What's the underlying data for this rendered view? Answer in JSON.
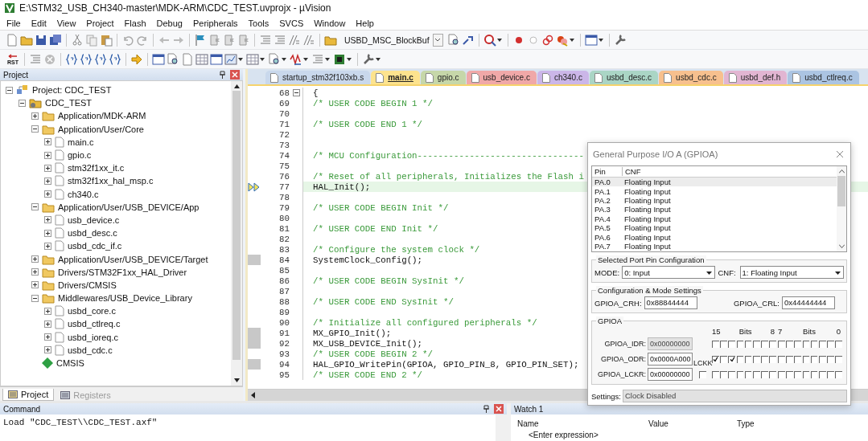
{
  "window": {
    "title": "E:\\STM32_USB_CH340-master\\MDK-ARM\\CDC_TEST.uvprojx - µVision"
  },
  "menu": [
    "File",
    "Edit",
    "View",
    "Project",
    "Flash",
    "Debug",
    "Peripherals",
    "Tools",
    "SVCS",
    "Window",
    "Help"
  ],
  "toolbar": {
    "find_field": {
      "value": "USBD_MSC_BlockBuf"
    },
    "reset_label": "RST"
  },
  "project": {
    "title": "Project",
    "tree": [
      {
        "label": "Project: CDC_TEST",
        "kind": "project",
        "expanded": true,
        "children": [
          {
            "label": "CDC_TEST",
            "kind": "target",
            "expanded": true,
            "children": [
              {
                "label": "Application/MDK-ARM",
                "kind": "group",
                "expanded": false
              },
              {
                "label": "Application/User/Core",
                "kind": "group",
                "expanded": true,
                "children": [
                  {
                    "label": "main.c",
                    "kind": "file",
                    "expanded": false
                  },
                  {
                    "label": "gpio.c",
                    "kind": "file",
                    "expanded": false
                  },
                  {
                    "label": "stm32f1xx_it.c",
                    "kind": "file",
                    "expanded": false
                  },
                  {
                    "label": "stm32f1xx_hal_msp.c",
                    "kind": "file",
                    "expanded": false
                  },
                  {
                    "label": "ch340.c",
                    "kind": "file",
                    "expanded": false
                  }
                ]
              },
              {
                "label": "Application/User/USB_DEVICE/App",
                "kind": "group",
                "expanded": true,
                "children": [
                  {
                    "label": "usb_device.c",
                    "kind": "file",
                    "expanded": false
                  },
                  {
                    "label": "usbd_desc.c",
                    "kind": "file",
                    "expanded": false
                  },
                  {
                    "label": "usbd_cdc_if.c",
                    "kind": "file",
                    "expanded": false
                  }
                ]
              },
              {
                "label": "Application/User/USB_DEVICE/Target",
                "kind": "group",
                "expanded": false
              },
              {
                "label": "Drivers/STM32F1xx_HAL_Driver",
                "kind": "group",
                "expanded": false
              },
              {
                "label": "Drivers/CMSIS",
                "kind": "group",
                "expanded": false
              },
              {
                "label": "Middlewares/USB_Device_Library",
                "kind": "group",
                "expanded": true,
                "children": [
                  {
                    "label": "usbd_core.c",
                    "kind": "file",
                    "expanded": false
                  },
                  {
                    "label": "usbd_ctlreq.c",
                    "kind": "file",
                    "expanded": false
                  },
                  {
                    "label": "usbd_ioreq.c",
                    "kind": "file",
                    "expanded": false
                  },
                  {
                    "label": "usbd_cdc.c",
                    "kind": "file",
                    "expanded": false
                  }
                ]
              },
              {
                "label": "CMSIS",
                "kind": "component"
              }
            ]
          }
        ]
      }
    ],
    "tabs": [
      {
        "label": "Project",
        "selected": true
      },
      {
        "label": "Registers",
        "selected": false
      }
    ]
  },
  "editor": {
    "tabs": [
      {
        "label": "startup_stm32f103xb.s",
        "selected": false,
        "color": "#c9d8ec"
      },
      {
        "label": "main.c",
        "selected": true,
        "color": "#fde38e"
      },
      {
        "label": "gpio.c",
        "selected": false,
        "color": "#c6d7a9"
      },
      {
        "label": "usb_device.c",
        "selected": false,
        "color": "#f0a8a8"
      },
      {
        "label": "ch340.c",
        "selected": false,
        "color": "#cbb6e8"
      },
      {
        "label": "usbd_desc.c",
        "selected": false,
        "color": "#aad5c5"
      },
      {
        "label": "usbd_cdc.c",
        "selected": false,
        "color": "#f7c08e"
      },
      {
        "label": "usbd_def.h",
        "selected": false,
        "color": "#e2b5d2"
      },
      {
        "label": "usbd_ctlreq.c",
        "selected": false,
        "color": "#abc4e2"
      }
    ],
    "lines": [
      {
        "number": "68",
        "text": "{",
        "kind": "code",
        "foldable": true,
        "executable": false,
        "current": false
      },
      {
        "number": "69",
        "text": "/* USER CODE BEGIN 1 */",
        "kind": "comment",
        "foldable": false,
        "executable": false,
        "current": false
      },
      {
        "number": "70",
        "foldable": false,
        "executable": false,
        "current": false
      },
      {
        "number": "71",
        "text": "/* USER CODE END 1 */",
        "kind": "comment",
        "foldable": false,
        "executable": false,
        "current": false
      },
      {
        "number": "72",
        "foldable": false,
        "executable": false,
        "current": false
      },
      {
        "number": "73",
        "foldable": false,
        "executable": false,
        "current": false
      },
      {
        "number": "74",
        "text": "/* MCU Configuration--------------------------------",
        "kind": "comment",
        "foldable": false,
        "executable": false,
        "current": false
      },
      {
        "number": "75",
        "foldable": false,
        "executable": false,
        "current": false
      },
      {
        "number": "76",
        "text": "/* Reset of all peripherals, Initializes the Flash i",
        "kind": "comment",
        "foldable": false,
        "executable": false,
        "current": false
      },
      {
        "number": "77",
        "text": "HAL_Init();",
        "kind": "code",
        "foldable": false,
        "executable": false,
        "current": true
      },
      {
        "number": "78",
        "foldable": false,
        "executable": false,
        "current": false
      },
      {
        "number": "79",
        "text": "/* USER CODE BEGIN Init */",
        "kind": "comment",
        "foldable": false,
        "executable": false,
        "current": false
      },
      {
        "number": "80",
        "foldable": false,
        "executable": false,
        "current": false
      },
      {
        "number": "81",
        "text": "/* USER CODE END Init */",
        "kind": "comment",
        "foldable": false,
        "executable": false,
        "current": false
      },
      {
        "number": "82",
        "foldable": false,
        "executable": false,
        "current": false
      },
      {
        "number": "83",
        "text": "/* Configure the system clock */",
        "kind": "comment",
        "foldable": false,
        "executable": false,
        "current": false
      },
      {
        "number": "84",
        "text": "SystemClock_Config();",
        "kind": "code",
        "foldable": false,
        "executable": true,
        "current": false
      },
      {
        "number": "85",
        "foldable": false,
        "executable": false,
        "current": false
      },
      {
        "number": "86",
        "text": "/* USER CODE BEGIN SysInit */",
        "kind": "comment",
        "foldable": false,
        "executable": false,
        "current": false
      },
      {
        "number": "87",
        "foldable": false,
        "executable": false,
        "current": false
      },
      {
        "number": "88",
        "text": "/* USER CODE END SysInit */",
        "kind": "comment",
        "foldable": false,
        "executable": false,
        "current": false
      },
      {
        "number": "89",
        "foldable": false,
        "executable": false,
        "current": false
      },
      {
        "number": "90",
        "text": "/* Initialize all configured peripherals */",
        "kind": "comment",
        "foldable": false,
        "executable": false,
        "current": false
      },
      {
        "number": "91",
        "text": "MX_GPIO_Init();",
        "kind": "code",
        "foldable": false,
        "executable": true,
        "current": false
      },
      {
        "number": "92",
        "text": "MX_USB_DEVICE_Init();",
        "kind": "code",
        "foldable": false,
        "executable": true,
        "current": false
      },
      {
        "number": "93",
        "text": "/* USER CODE BEGIN 2 */",
        "kind": "comment",
        "foldable": false,
        "executable": false,
        "current": false
      },
      {
        "number": "94",
        "text": "HAL_GPIO_WritePin(GPIOA, GPIO_PIN_8, GPIO_PIN_SET);",
        "kind": "code",
        "foldable": false,
        "executable": true,
        "current": false
      },
      {
        "number": "95",
        "text": "/* USER CODE END 2 */",
        "kind": "comment",
        "foldable": false,
        "executable": false,
        "current": false
      }
    ]
  },
  "command": {
    "title": "Command",
    "output": "Load \"CDC_TEST\\\\CDC_TEST.axf\""
  },
  "watch": {
    "title": "Watch 1",
    "columns": [
      "Name",
      "Value",
      "Type"
    ],
    "placeholder_row": "<Enter expression>"
  },
  "dialog": {
    "title": "General Purpose I/O A (GPIOA)",
    "columns": [
      "Pin",
      "CNF"
    ],
    "pins": [
      {
        "pin": "PA.0",
        "cnf": "Floating Input",
        "selected": true
      },
      {
        "pin": "PA.1",
        "cnf": "Floating Input",
        "selected": false
      },
      {
        "pin": "PA.2",
        "cnf": "Floating Input",
        "selected": false
      },
      {
        "pin": "PA.3",
        "cnf": "Floating Input",
        "selected": false
      },
      {
        "pin": "PA.4",
        "cnf": "Floating Input",
        "selected": false
      },
      {
        "pin": "PA.5",
        "cnf": "Floating Input",
        "selected": false
      },
      {
        "pin": "PA.6",
        "cnf": "Floating Input",
        "selected": false
      },
      {
        "pin": "PA.7",
        "cnf": "Floating Input",
        "selected": false
      }
    ],
    "pin_config": {
      "title": "Selected Port Pin Configuration",
      "mode_label": "MODE:",
      "mode_value": "0: Input",
      "cnf_label": "CNF:",
      "cnf_value": "1: Floating Input"
    },
    "mode_settings": {
      "title": "Configuration & Mode Settings",
      "crh_label": "GPIOA_CRH:",
      "crh_value": "0x88844444",
      "crl_label": "GPIOA_CRL:",
      "crl_value": "0x44444444"
    },
    "port": {
      "title": "GPIOA",
      "bit_header": [
        "15",
        "Bits",
        "8",
        "7",
        "Bits",
        "0"
      ],
      "lckk": {
        "label": "LCKK",
        "checked": false
      },
      "registers": [
        {
          "label": "GPIOA_IDR:",
          "value": "0x00000000",
          "readonly": true,
          "bits": [
            false,
            false,
            false,
            false,
            false,
            false,
            false,
            false,
            false,
            false,
            false,
            false,
            false,
            false,
            false,
            false
          ]
        },
        {
          "label": "GPIOA_ODR:",
          "value": "0x0000A000",
          "readonly": false,
          "bits": [
            true,
            false,
            true,
            false,
            false,
            false,
            false,
            false,
            false,
            false,
            false,
            false,
            false,
            false,
            false,
            false
          ]
        },
        {
          "label": "GPIOA_LCKR:",
          "value": "0x00000000",
          "readonly": false,
          "bits": [
            false,
            false,
            false,
            false,
            false,
            false,
            false,
            false,
            false,
            false,
            false,
            false,
            false,
            false,
            false,
            false
          ]
        }
      ]
    },
    "settings": {
      "label": "Settings:",
      "value": "Clock Disabled"
    }
  }
}
